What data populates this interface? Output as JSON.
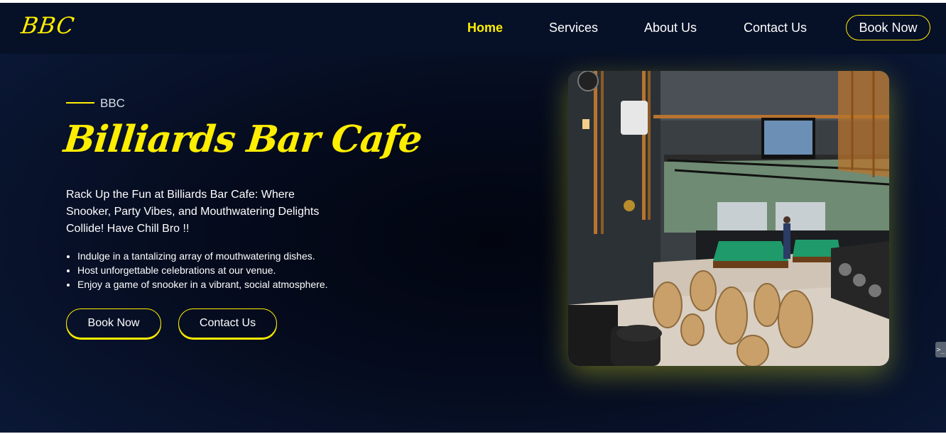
{
  "header": {
    "logo": "BBC",
    "nav": [
      {
        "label": "Home",
        "active": true
      },
      {
        "label": "Services"
      },
      {
        "label": "About Us"
      },
      {
        "label": "Contact Us"
      }
    ],
    "cta_label": "Book Now"
  },
  "hero": {
    "eyebrow": "BBC",
    "title": "Billiards Bar Cafe",
    "tagline": "Rack Up the Fun at Billiards Bar Cafe: Where Snooker, Party Vibes, and Mouthwatering Delights Collide! Have Chill Bro !!",
    "bullets": [
      "Indulge in a tantalizing array of mouthwatering dishes.",
      "Host unforgettable celebrations at our venue.",
      "Enjoy a game of snooker in a vibrant, social atmosphere."
    ],
    "primary_button": "Book Now",
    "secondary_button": "Contact Us"
  },
  "side_handle_glyph": ">_",
  "colors": {
    "accent": "#ffee00",
    "background": "#050b1d",
    "header_bg": "#061027",
    "text": "#ffffff"
  }
}
